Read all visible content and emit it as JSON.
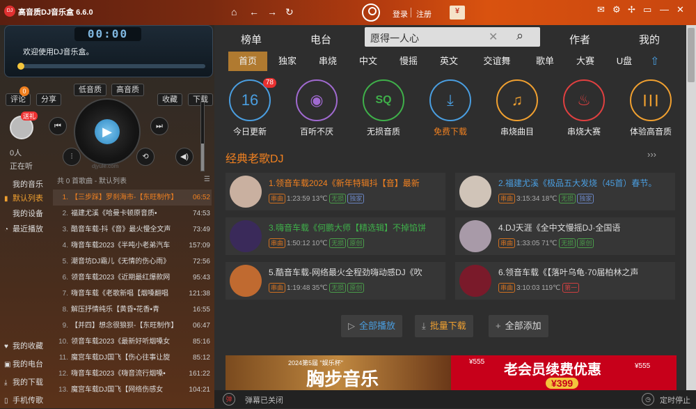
{
  "app": {
    "logo_text": "DJ",
    "title": "高音质DJ音乐盒 6.6.0"
  },
  "topbar": {
    "home_icon": "⌂",
    "back_icon": "←",
    "forward_icon": "→",
    "refresh_icon": "↻",
    "login": "登录",
    "register": "注册",
    "gift_icon": "¥",
    "win_icons": [
      "✉",
      "⚙",
      "✢",
      "▭",
      "—",
      "✕"
    ]
  },
  "player": {
    "time": "00:00",
    "welcome": "欢迎使用DJ音乐盒。",
    "progress": 0,
    "volume": 0.4,
    "comment": "评论",
    "comment_badge": "0",
    "share": "分享",
    "low_quality": "低音质",
    "high_quality": "高音质",
    "favorite": "收藏",
    "download": "下载",
    "gift": "送礼",
    "listen_count": "0人",
    "listen_label": "正在听",
    "play_icon": "▶",
    "prev_icon": "⏮",
    "next_icon": "⏭",
    "eq_icon": "⫶",
    "loop_icon": "⟲",
    "vol_icon": "◀)",
    "site": "djyule.com"
  },
  "sidenav": {
    "items": [
      {
        "icon": "",
        "label": "我的音乐"
      },
      {
        "icon": "▮",
        "label": "默认列表"
      },
      {
        "icon": "",
        "label": "我的设备"
      },
      {
        "icon": "◔",
        "label": "最近播放"
      },
      {
        "icon": "♥",
        "label": "我的收藏"
      },
      {
        "icon": "▣",
        "label": "我的电台"
      },
      {
        "icon": "⤓",
        "label": "我的下载"
      },
      {
        "icon": "▯",
        "label": "手机传歌"
      }
    ]
  },
  "playlist": {
    "header": "共 0 首歌曲 - 默认列表",
    "menu_icon": "☰",
    "rows": [
      {
        "num": "1.",
        "title": "【三步踩】罗刹海市-【东旺制作】",
        "dur": "06:52"
      },
      {
        "num": "2.",
        "title": "福建尤溪《哈曼卡顿原音质•",
        "dur": "74:53"
      },
      {
        "num": "3.",
        "title": "酷音车载-抖《音》最火慢全文声",
        "dur": "73:49"
      },
      {
        "num": "4.",
        "title": "嗨音车载2023《半吨小老弟汽车",
        "dur": "157:09"
      },
      {
        "num": "5.",
        "title": "潮音坊DJ霜儿《无情的伤心雨》",
        "dur": "72:56"
      },
      {
        "num": "6.",
        "title": "领音车载2023《近期最红爆款网",
        "dur": "95:43"
      },
      {
        "num": "7.",
        "title": "嗨音车载《老歌新唱【烟嗓翻唱",
        "dur": "121:38"
      },
      {
        "num": "8.",
        "title": "解压抒情纯乐【黄昏•花香•青",
        "dur": "16:55"
      },
      {
        "num": "9.",
        "title": "【并四】想念很狼狈-【东旺制作】",
        "dur": "06:47"
      },
      {
        "num": "10.",
        "title": "领音车载2023《最新好听烟嗓女",
        "dur": "85:16"
      },
      {
        "num": "11.",
        "title": "魔宫车载DJ国飞【伤心往事让旋",
        "dur": "85:12"
      },
      {
        "num": "12.",
        "title": "嗨音车载2023《嗨音流行烟嗓•",
        "dur": "161:22"
      },
      {
        "num": "13.",
        "title": "魔宫车载DJ国飞【网络伤感女",
        "dur": "104:21"
      }
    ]
  },
  "tabs": {
    "top": [
      "榜单",
      "电台",
      "作者",
      "我的"
    ],
    "search_value": "愿得一人心",
    "clear_icon": "✕",
    "search_icon": "⌕",
    "sub": [
      "首页",
      "独家",
      "串烧",
      "中文",
      "慢摇",
      "英文",
      "交谊舞",
      "歌单",
      "大赛",
      "U盘"
    ],
    "up_icon": "⇧"
  },
  "categories": [
    {
      "label": "今日更新",
      "icon": "16",
      "badge": "78",
      "color": "#4a9ee0"
    },
    {
      "label": "百听不厌",
      "icon": "◉",
      "color": "#a06ad0"
    },
    {
      "label": "无损音质",
      "icon": "SQ",
      "color": "#3fb04a"
    },
    {
      "label": "免费下载",
      "icon": "⤓",
      "color": "#4a9ee0"
    },
    {
      "label": "串烧曲目",
      "icon": "♫",
      "color": "#f0a030"
    },
    {
      "label": "串烧大赛",
      "icon": "♨",
      "color": "#e04040"
    },
    {
      "label": "体验高音质",
      "icon": "┃┃┃",
      "color": "#f0a030"
    }
  ],
  "section": {
    "title": "经典老歌DJ",
    "more_icon": "›››"
  },
  "cards": [
    {
      "title": "1.领音车载2024《新年特辑抖【音】最新",
      "tag1": "串曲",
      "meta": "1:23:59  13℃",
      "tags": [
        "无损",
        "独家"
      ],
      "title_color": "#f08020",
      "thumb": "#c9b0a0"
    },
    {
      "title": "2.福建尤溪《极品五大发烧（45首）春节。",
      "tag1": "串曲",
      "meta": "3:15:34  18℃",
      "tags": [
        "无损",
        "独家"
      ],
      "title_color": "#4a9ee0",
      "thumb": "#d0c4b8"
    },
    {
      "title": "3.嗨音车载《何鹏大师【精选辑】不掉馅饼",
      "tag1": "串曲",
      "meta": "1:50:12  10℃",
      "tags": [
        "无损",
        "原创"
      ],
      "title_color": "#3fb04a",
      "thumb": "#3a2a5a"
    },
    {
      "title": "4.DJ天涯《全中文慢摇DJ·全国语",
      "tag1": "串曲",
      "meta": "1:33:05  71℃",
      "tags": [
        "无损",
        "原创"
      ],
      "title_color": "#ddd",
      "thumb": "#a89aa8"
    },
    {
      "title": "5.酷音车载-网络最火全程劲嗨动感DJ《吹",
      "tag1": "串曲",
      "meta": "1:19:48  35℃",
      "tags": [
        "无损",
        "原创"
      ],
      "title_color": "#ddd",
      "thumb": "#c06a30"
    },
    {
      "title": "6.领音车载《【落叶乌龟·70届柏林之声",
      "tag1": "串曲",
      "meta": "3:10:03  119℃",
      "tags": [
        "第一"
      ],
      "title_color": "#ddd",
      "thumb": "#7a1a2a"
    }
  ],
  "actions": [
    {
      "icon": "▷",
      "label": "全部播放",
      "color": "#4a9ee0"
    },
    {
      "icon": "⤓",
      "label": "批量下载",
      "color": "#f0a030"
    },
    {
      "icon": "+",
      "label": "全部添加",
      "color": "#ddd"
    }
  ],
  "banners": {
    "b1_sub": "2024第5届 \"娱乐杯\"",
    "b1_main": "胸步音乐",
    "b2_title": "老会员续费优惠",
    "b2_price": "¥399",
    "b2_p1": "¥555",
    "b2_p2": "¥555"
  },
  "bottom": {
    "danmu": "弹幕已关闭",
    "timer": "定时停止",
    "danmu_icon": "弹",
    "timer_icon": "◷"
  }
}
